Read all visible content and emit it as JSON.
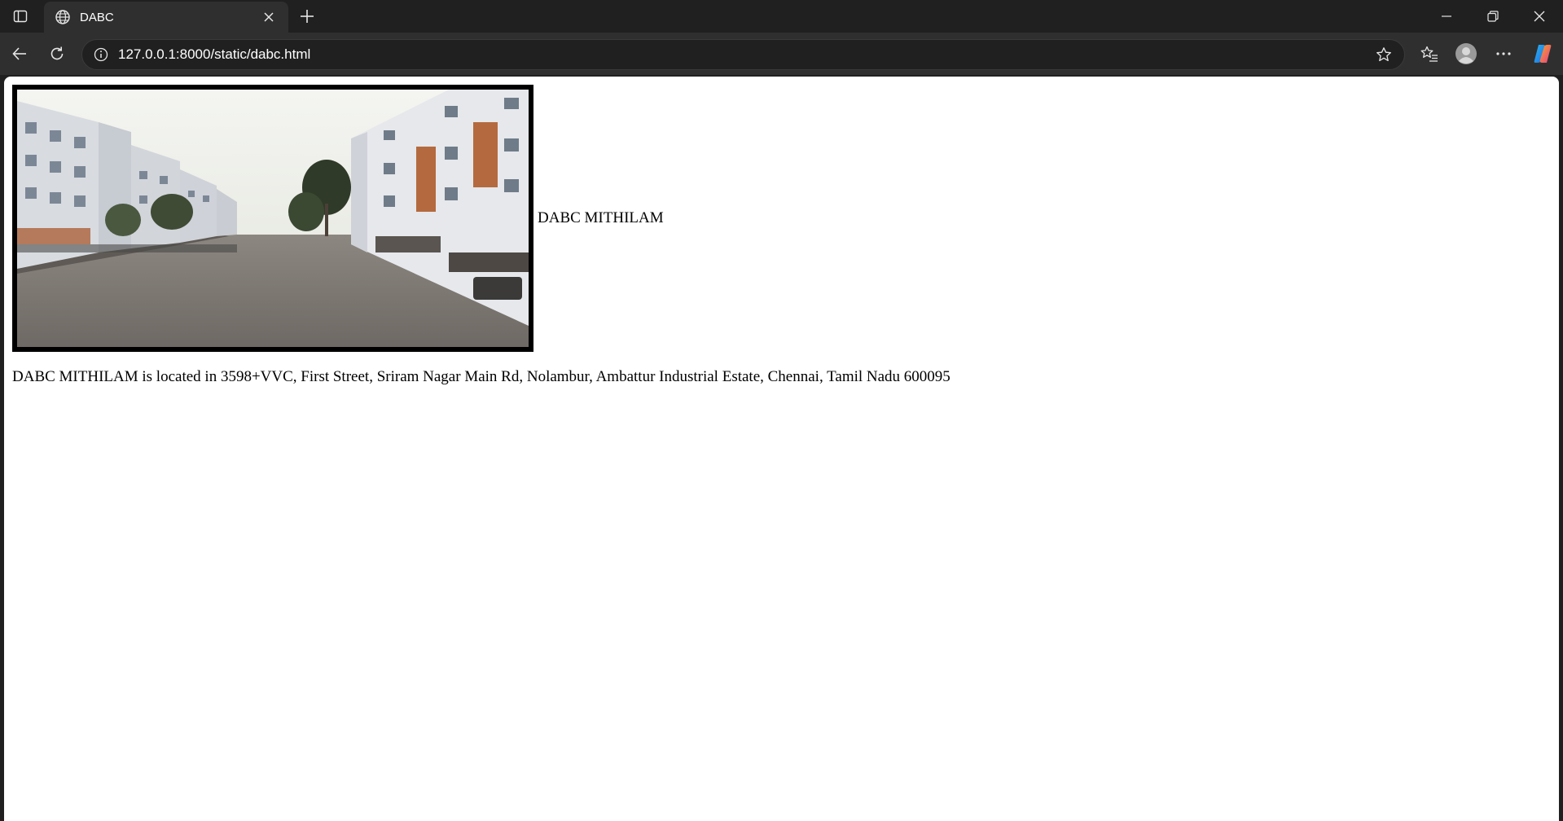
{
  "browser": {
    "tab": {
      "title": "DABC",
      "favicon": "globe-icon"
    },
    "address": {
      "url": "127.0.0.1:8000/static/dabc.html"
    },
    "icons": {
      "sidebar": "sidebar-toggle-icon",
      "close_tab": "close-icon",
      "new_tab": "plus-icon",
      "minimize": "minimize-icon",
      "restore": "restore-icon",
      "close_window": "close-icon",
      "back": "back-arrow-icon",
      "refresh": "refresh-icon",
      "site_info": "info-icon",
      "favorite": "star-icon",
      "favorites": "favorites-icon",
      "profile": "profile-icon",
      "menu": "more-icon",
      "copilot": "copilot-icon"
    }
  },
  "page": {
    "title": "DABC MITHILAM",
    "description": "DABC MITHILAM is located in 3598+VVC, First Street, Sriram Nagar Main Rd, Nolambur, Ambattur Industrial Estate, Chennai, Tamil Nadu 600095",
    "image": {
      "subject": "apartment-street-photo"
    }
  },
  "colors": {
    "chrome_dark": "#202020",
    "chrome_tab": "#2f2f2f",
    "page_bg": "#ffffff",
    "text": "#000000"
  }
}
